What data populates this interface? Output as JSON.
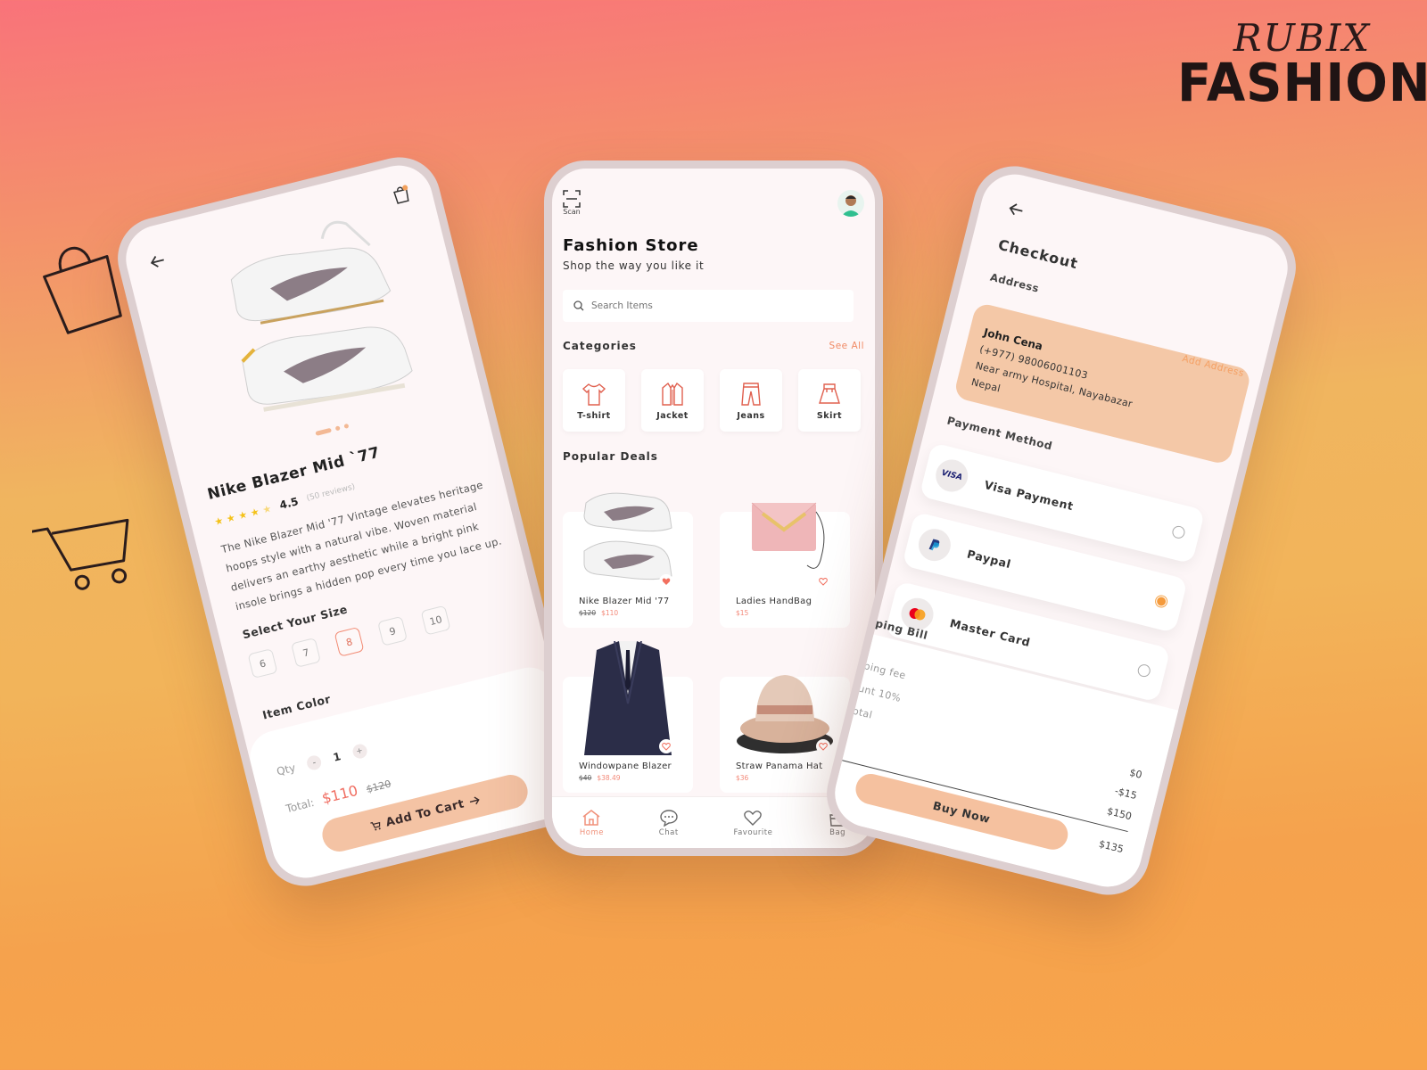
{
  "brand": {
    "top": "RUBIX",
    "bottom": "FASHION"
  },
  "decor": {
    "bag_icon": "shopping-bag-outline-icon",
    "cart_icon": "shopping-cart-outline-icon"
  },
  "colors": {
    "accent": "#f28b74",
    "cta": "#f4c3a4",
    "address_card": "#f4c8a7",
    "radio_selected": "#f59a3b"
  },
  "product_detail": {
    "name": "Nike Blazer Mid `77",
    "rating": "4.5",
    "stars": 4.5,
    "reviews": "(50 reviews)",
    "description": "The Nike Blazer Mid '77 Vintage elevates heritage hoops style with a natural vibe. Woven material delivers an earthy aesthetic while a bright pink insole brings a hidden pop every time you lace up.",
    "size_title": "Select Your Size",
    "sizes": [
      "6",
      "7",
      "8",
      "9",
      "10"
    ],
    "selected_size": "8",
    "color_title": "Item Color",
    "colors": [
      "#fdf6f4",
      "#1f1f1f",
      "#3a3af0"
    ],
    "selected_color_check": "✓",
    "qty_label": "Qty",
    "qty_minus": "-",
    "qty_value": "1",
    "qty_plus": "+",
    "total_label": "Total:",
    "price": "$110",
    "old_price": "$120",
    "cart_button": "Add To Cart"
  },
  "home": {
    "scan_label": "Scan",
    "title": "Fashion Store",
    "subtitle": "Shop the way you like it",
    "search_placeholder": "Search Items",
    "categories_title": "Categories",
    "see_all": "See All",
    "categories": [
      {
        "label": "T-shirt",
        "icon": "tshirt-icon"
      },
      {
        "label": "Jacket",
        "icon": "jacket-icon"
      },
      {
        "label": "Jeans",
        "icon": "jeans-icon"
      },
      {
        "label": "Skirt",
        "icon": "skirt-icon"
      }
    ],
    "popular_title": "Popular Deals",
    "deals": [
      {
        "name": "Nike Blazer Mid '77",
        "old_price": "$120",
        "price": "$110",
        "favorited": true
      },
      {
        "name": "Ladies HandBag",
        "old_price": "",
        "price": "$15",
        "favorited": false
      },
      {
        "name": "Windowpane Blazer",
        "old_price": "$40",
        "price": "$38.49",
        "favorited": false
      },
      {
        "name": "Straw Panama Hat",
        "old_price": "",
        "price": "$36",
        "favorited": false
      }
    ],
    "nav": [
      {
        "label": "Home",
        "icon": "home-icon",
        "active": true
      },
      {
        "label": "Chat",
        "icon": "chat-icon",
        "active": false
      },
      {
        "label": "Favourite",
        "icon": "heart-icon",
        "active": false
      },
      {
        "label": "Bag",
        "icon": "bag-icon",
        "active": false
      }
    ]
  },
  "checkout": {
    "title": "Checkout",
    "address_title": "Address",
    "add_address": "Add Address",
    "address": {
      "name": "John Cena",
      "phone": "(+977) 98006001103",
      "line1": "Near army Hospital, Nayabazar",
      "line2": "Nepal"
    },
    "payment_title": "Payment Method",
    "payments": [
      {
        "name": "Visa Payment",
        "logo": "VISA",
        "selected": false
      },
      {
        "name": "Paypal",
        "logo": "paypal-icon",
        "selected": true
      },
      {
        "name": "Master Card",
        "logo": "mastercard-icon",
        "selected": false
      }
    ],
    "bill_title": "pping Bill",
    "bill_rows": [
      {
        "label": "ping fee",
        "value": "$0"
      },
      {
        "label": "unt 10%",
        "value": "-$15"
      },
      {
        "label": "otal",
        "value": "$150"
      }
    ],
    "total_value": "$135",
    "buy_button": "Buy Now"
  }
}
